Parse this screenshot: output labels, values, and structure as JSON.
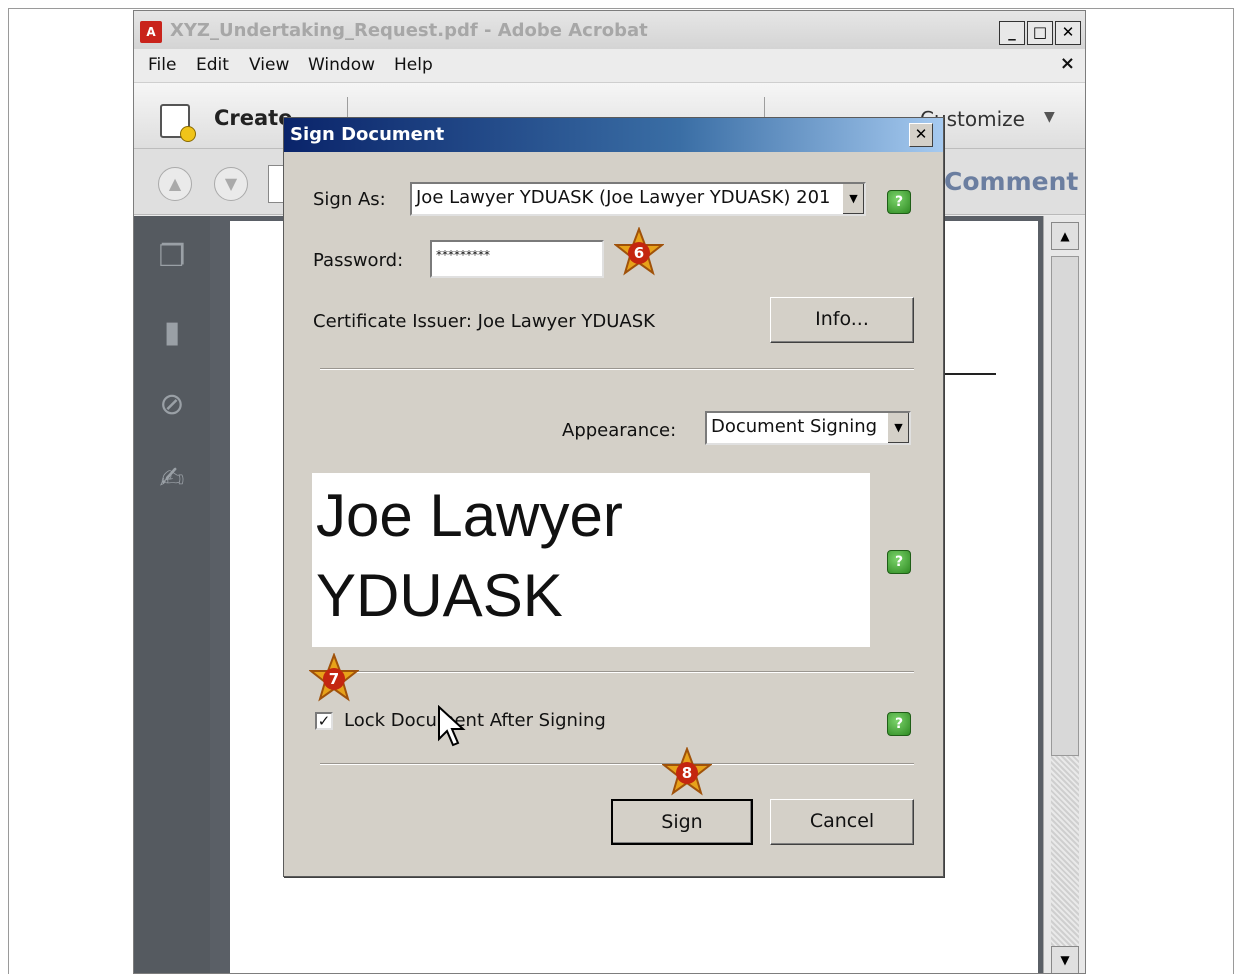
{
  "window": {
    "title": "XYZ_Undertaking_Request.pdf - Adobe Acrobat",
    "minimize": "_",
    "maximize": "□",
    "close": "✕"
  },
  "menu": {
    "items": [
      "File",
      "Edit",
      "View",
      "Window",
      "Help"
    ],
    "close": "×"
  },
  "toolbar": {
    "create_label": "Create",
    "customize_label": "Customize"
  },
  "nav": {
    "comment_label": "Comment"
  },
  "dialog": {
    "title": "Sign Document",
    "close": "✕",
    "sign_as_label": "Sign As:",
    "sign_as_value": "Joe Lawyer YDUASK (Joe Lawyer YDUASK) 201",
    "password_label": "Password:",
    "password_value": "*********",
    "cert_issuer": "Certificate Issuer: Joe Lawyer YDUASK",
    "info_button": "Info...",
    "appearance_label": "Appearance:",
    "appearance_value": "Document Signing",
    "signature_preview": [
      "Joe Lawyer",
      "YDUASK"
    ],
    "lock_label": "Lock Document After Signing",
    "lock_checked": true,
    "sign_button": "Sign",
    "cancel_button": "Cancel"
  },
  "annotations": {
    "step6": "6",
    "step7": "7",
    "step8": "8"
  },
  "colors": {
    "dialog_title_start": "#0a246a",
    "dialog_title_end": "#a6caf0",
    "help_green": "#2e8a22",
    "step_star": "#e7a21a"
  }
}
